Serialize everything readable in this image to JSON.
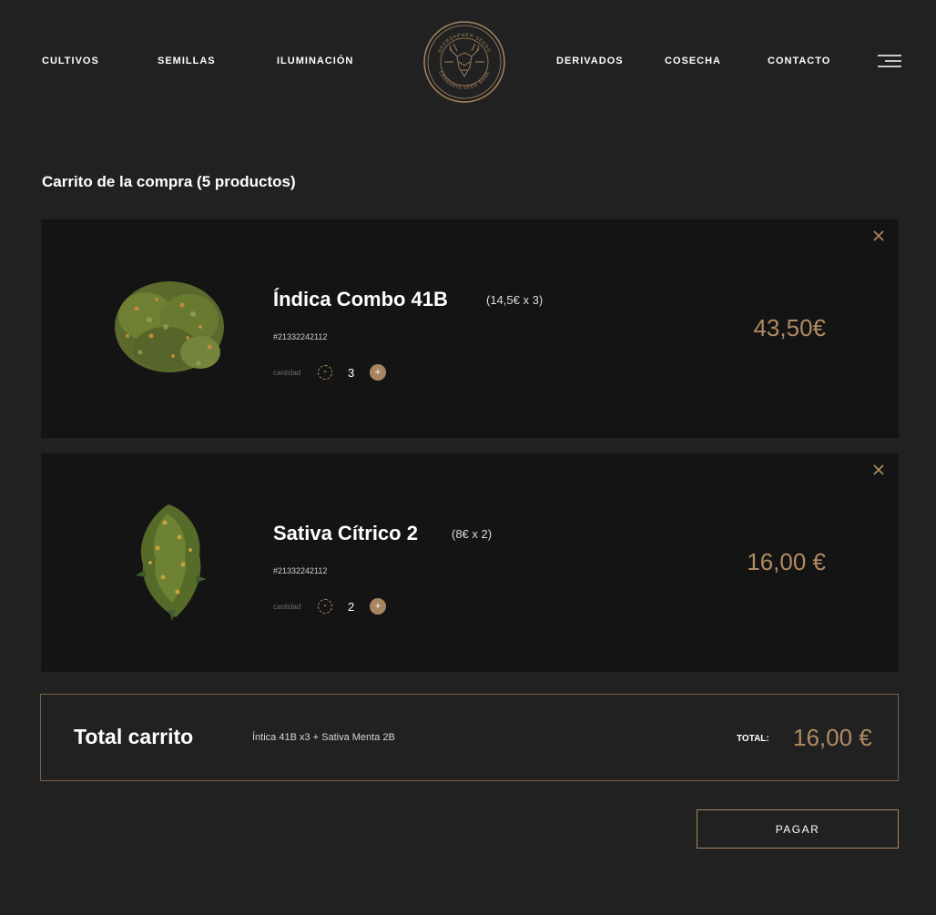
{
  "nav": {
    "left": [
      "CULTIVOS",
      "SEMILLAS",
      "ILUMINACIÓN"
    ],
    "right": [
      "DERIVADOS",
      "COSECHA",
      "CONTACTO"
    ],
    "logo_text": {
      "top": "DEERSAPHER SEEDS",
      "bottom": "CANNABIS SEED BANK"
    },
    "menu_icon": "hamburger-menu-icon"
  },
  "cart": {
    "title": "Carrito de la compra (5 productos)",
    "items": [
      {
        "name": "Índica Combo 41B",
        "unit": "(14,5€ x 3)",
        "sku": "#21332242112",
        "qty_label": "cantidad",
        "qty": "3",
        "minus": "-",
        "plus": "+",
        "price": "43,50€"
      },
      {
        "name": "Sativa Cítrico 2",
        "unit": "(8€ x 2)",
        "sku": "#21332242112",
        "qty_label": "cantidad",
        "qty": "2",
        "minus": "-",
        "plus": "+",
        "price": "16,00 €"
      }
    ]
  },
  "total": {
    "title": "Total carrito",
    "summary": "Íntica 41B x3 + Sativa Menta 2B",
    "label": "TOTAL:",
    "value": "16,00 €"
  },
  "pay_button": "PAGAR",
  "colors": {
    "background": "#212121",
    "card": "#141414",
    "accent": "#b08a62",
    "accent_fill": "#a78560"
  }
}
